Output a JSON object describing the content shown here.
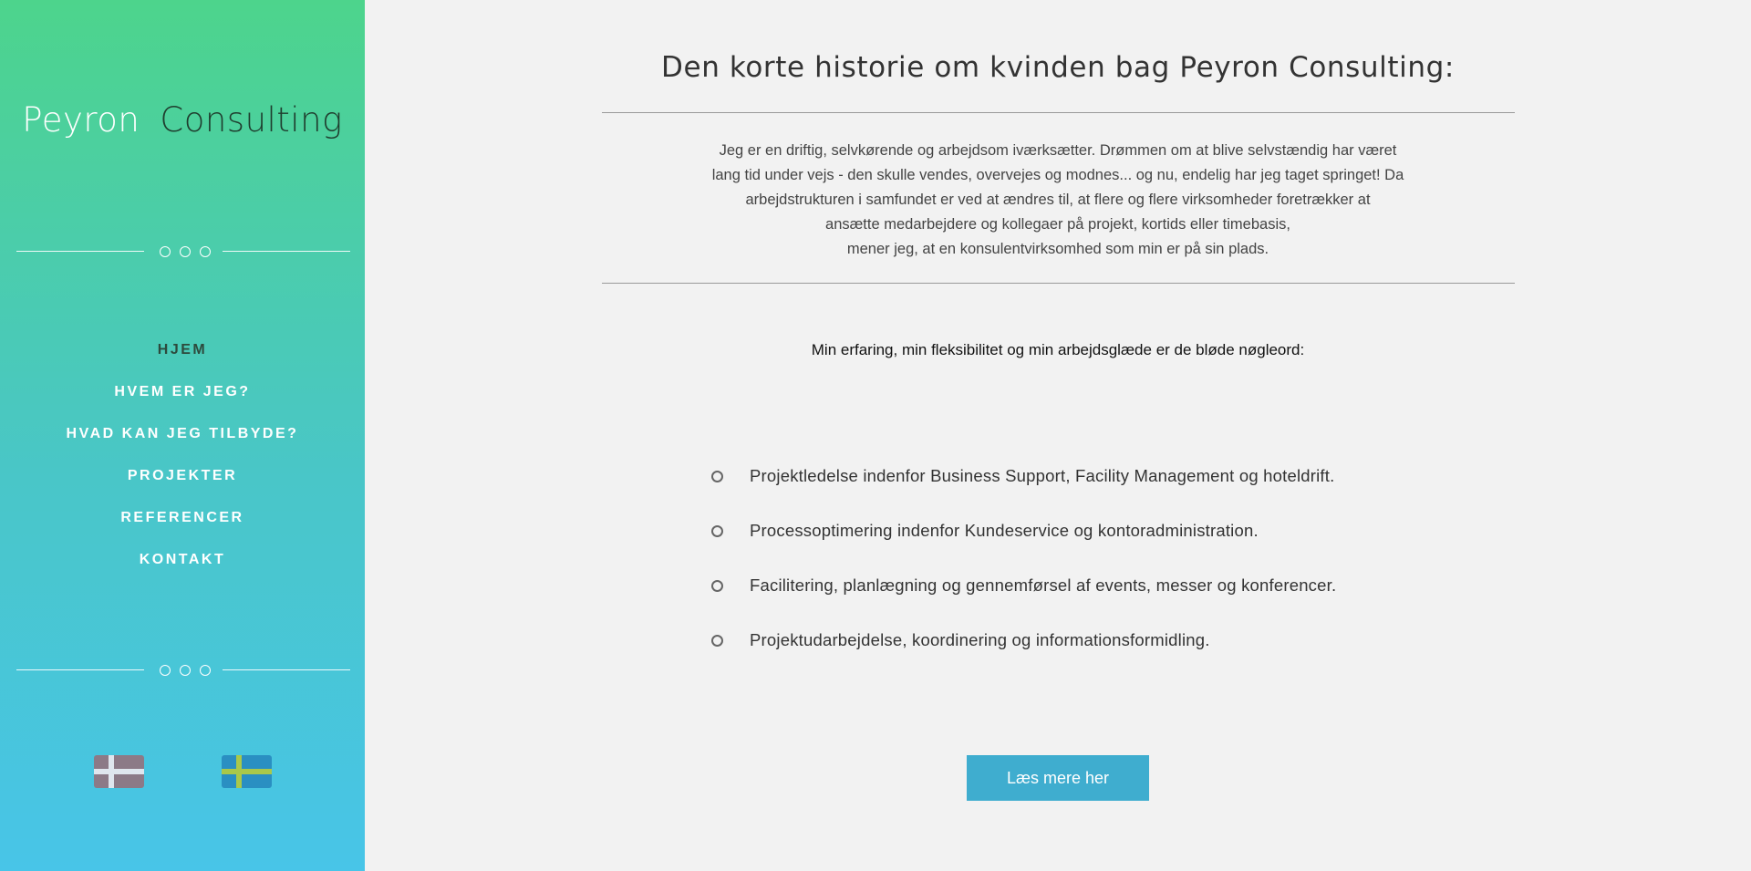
{
  "sidebar": {
    "logo": {
      "word1": "Peyron",
      "word2": "Consulting"
    },
    "nav": [
      {
        "label": "HJEM"
      },
      {
        "label": "HVEM ER JEG?"
      },
      {
        "label": "HVAD KAN JEG TILBYDE?"
      },
      {
        "label": "PROJEKTER"
      },
      {
        "label": "REFERENCER"
      },
      {
        "label": "KONTAKT"
      }
    ],
    "active_nav": "HJEM",
    "flags": [
      "danish-flag-icon",
      "swedish-flag-icon"
    ]
  },
  "main": {
    "title": "Den korte historie om kvinden bag Peyron Consulting:",
    "intro_lines": [
      "Jeg er en driftig, selvkørende og arbejdsom iværksætter. Drømmen om at blive selvstændig har været",
      "lang tid under vejs - den skulle vendes, overvejes og modnes... og nu, endelig har jeg taget springet! Da",
      "arbejdstrukturen i samfundet er ved at ændres til, at flere og flere virksomheder foretrækker at",
      "ansætte medarbejdere og kollegaer på projekt, kortids eller timebasis,",
      "mener jeg, at en konsulentvirksomhed som min er på sin plads."
    ],
    "keyword": "Min erfaring, min fleksibilitet og min arbejdsglæde er de bløde nøgleord:",
    "list": [
      "Projektledelse indenfor Business Support, Facility Management og hoteldrift.",
      "Processoptimering indenfor Kundeservice og kontoradministration.",
      "Facilitering, planlægning og gennemførsel af events, messer og konferencer.",
      "Projektudarbejdelse, koordinering og informationsformidling."
    ],
    "button_label": "Læs mere her"
  },
  "colors": {
    "sidebar_top": "#4dd48c",
    "sidebar_bottom": "#48c5e8",
    "button": "#3fadcf",
    "background": "#f2f2f2"
  }
}
